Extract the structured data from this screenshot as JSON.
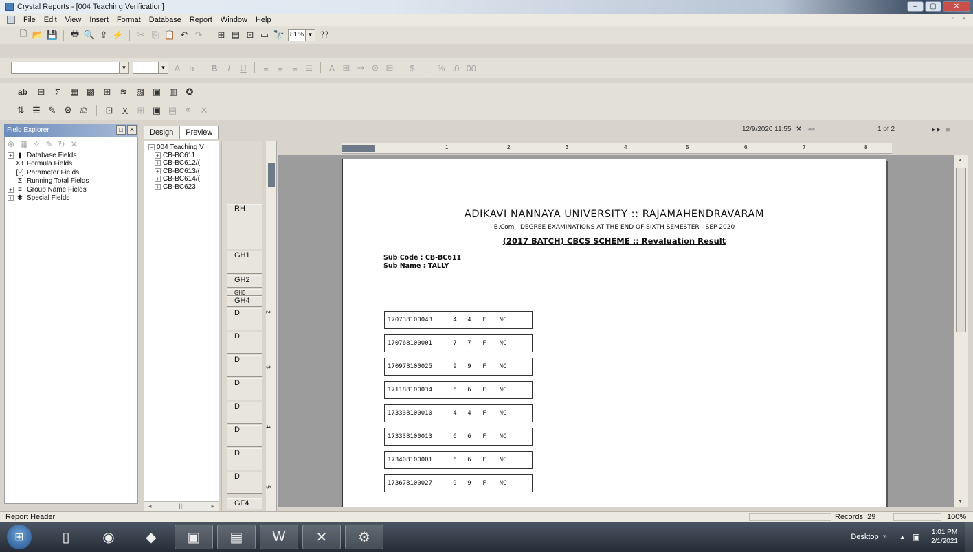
{
  "window": {
    "title": "Crystal Reports - [004 Teaching Verification]"
  },
  "menu": [
    "File",
    "Edit",
    "View",
    "Insert",
    "Format",
    "Database",
    "Report",
    "Window",
    "Help"
  ],
  "toolbar": {
    "zoom_value": "81%"
  },
  "field_explorer": {
    "title": "Field Explorer",
    "items": [
      {
        "label": "Database Fields",
        "icon": "database-icon",
        "symbol": "▮",
        "expand": "+"
      },
      {
        "label": "Formula Fields",
        "icon": "formula-icon",
        "symbol": "X+",
        "expand": ""
      },
      {
        "label": "Parameter Fields",
        "icon": "parameter-icon",
        "symbol": "[?]",
        "expand": ""
      },
      {
        "label": "Running Total Fields",
        "icon": "sigma-icon",
        "symbol": "Σ",
        "expand": ""
      },
      {
        "label": "Group Name Fields",
        "icon": "group-icon",
        "symbol": "≡",
        "expand": "+"
      },
      {
        "label": "Special Fields",
        "icon": "special-icon",
        "symbol": "✱",
        "expand": "+"
      }
    ]
  },
  "tabs": [
    "Design",
    "Preview"
  ],
  "tree": {
    "root": "004 Teaching V",
    "children": [
      "CB-BC611",
      "CB-BC612/(",
      "CB-BC613/(",
      "CB-BC614/(",
      "CB-BC623"
    ]
  },
  "sections": [
    "RH",
    "GH1",
    "GH2",
    "GH3",
    "GH4",
    "D",
    "D",
    "D",
    "D",
    "D",
    "D",
    "D",
    "D",
    "GF4"
  ],
  "nav": {
    "datetime": "12/9/2020 11:55",
    "page": "1 of 2"
  },
  "report": {
    "title": "ADIKAVI NANNAYA UNIVERSITY :: RAJAMAHENDRAVARAM",
    "subtitle_prefix": "B.Com",
    "subtitle": "DEGREE EXAMINATIONS  AT THE END OF SIXTH SEMESTER - SEP 2020",
    "scheme": "(2017 BATCH) CBCS SCHEME :: Revaluation Result",
    "sub_code": "Sub Code :  CB-BC611",
    "sub_name": "Sub Name : TALLY",
    "rows": [
      [
        "170738100043",
        "4",
        "4",
        "F",
        "NC"
      ],
      [
        "170768100001",
        "7",
        "7",
        "F",
        "NC"
      ],
      [
        "170978100025",
        "9",
        "9",
        "F",
        "NC"
      ],
      [
        "171188100034",
        "6",
        "6",
        "F",
        "NC"
      ],
      [
        "173338100010",
        "4",
        "4",
        "F",
        "NC"
      ],
      [
        "173338100013",
        "6",
        "6",
        "F",
        "NC"
      ],
      [
        "173408100001",
        "6",
        "6",
        "F",
        "NC"
      ],
      [
        "173678100027",
        "9",
        "9",
        "F",
        "NC"
      ]
    ]
  },
  "status": {
    "left": "Report Header",
    "records": "Records: 29",
    "zoom": "100%"
  },
  "taskbar": {
    "desktop": "Desktop",
    "time": "1:01 PM",
    "date": "2/1/2021"
  }
}
